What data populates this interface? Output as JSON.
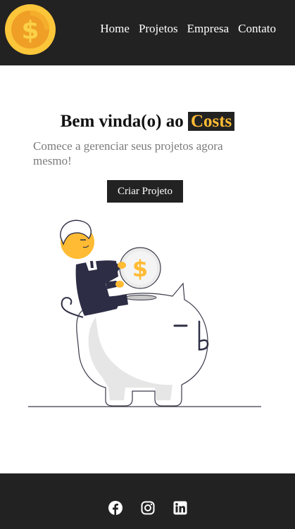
{
  "navbar": {
    "logo_icon": "dollar-coin-icon",
    "links": [
      "Home",
      "Projetos",
      "Empresa",
      "Contato"
    ]
  },
  "hero": {
    "title_prefix": "Bem vinda(o) ao",
    "title_brand": "Costs",
    "subtitle": "Comece a gerenciar seus projetos agora mesmo!",
    "cta_label": "Criar Projeto",
    "illustration": "person-saving-coin-in-piggy-bank"
  },
  "footer": {
    "social_icons": [
      "facebook-icon",
      "instagram-icon",
      "linkedin-icon"
    ]
  },
  "colors": {
    "dark": "#222222",
    "accent": "#ffbb33",
    "white": "#ffffff",
    "muted_text": "#7b7b7b"
  }
}
